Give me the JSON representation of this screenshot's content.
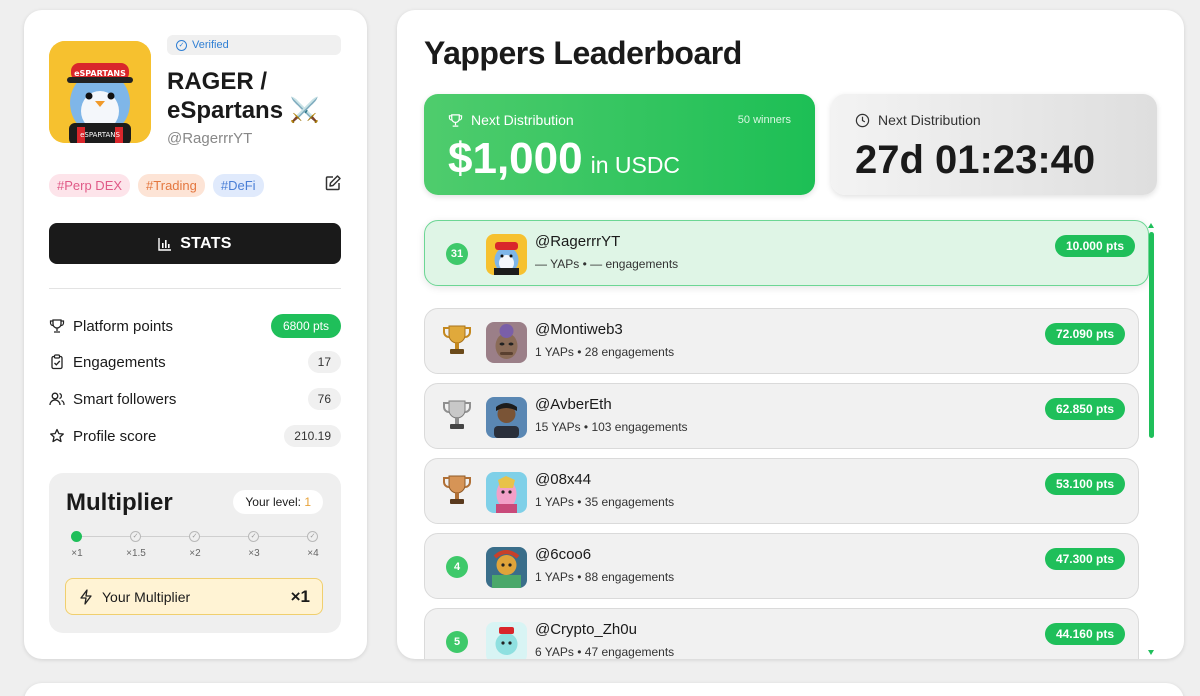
{
  "profile": {
    "verified": "Verified",
    "name": "RAGER / eSpartans ⚔️",
    "handle": "@RagerrrYT",
    "tags": [
      "#Perp DEX",
      "#Trading",
      "#DeFi"
    ],
    "stats_button": "STATS",
    "stats": [
      {
        "label": "Platform points",
        "value": "6800 pts",
        "icon": "trophy-icon"
      },
      {
        "label": "Engagements",
        "value": "17",
        "icon": "clipboard-icon"
      },
      {
        "label": "Smart followers",
        "value": "76",
        "icon": "users-icon"
      },
      {
        "label": "Profile score",
        "value": "210.19",
        "icon": "star-icon"
      }
    ]
  },
  "multiplier": {
    "title": "Multiplier",
    "level_label": "Your level:",
    "level_value": "1",
    "steps": [
      "×1",
      "×1.5",
      "×2",
      "×3",
      "×4"
    ],
    "your_multiplier_label": "Your Multiplier",
    "your_multiplier_value": "×1"
  },
  "leaderboard": {
    "title": "Yappers Leaderboard",
    "prize": {
      "label": "Next Distribution",
      "winners": "50 winners",
      "amount": "$1,000",
      "unit": "in USDC"
    },
    "countdown": {
      "label": "Next Distribution",
      "timer": "27d 01:23:40"
    },
    "entries": [
      {
        "rank": "31",
        "handle": "@RagerrrYT",
        "sub": "— YAPs • — engagements",
        "points": "10.000 pts",
        "me": true
      },
      {
        "rank": "gold",
        "handle": "@Montiweb3",
        "sub": "1 YAPs • 28 engagements",
        "points": "72.090 pts"
      },
      {
        "rank": "silver",
        "handle": "@AvberEth",
        "sub": "15 YAPs • 103 engagements",
        "points": "62.850 pts"
      },
      {
        "rank": "bronze",
        "handle": "@08x44",
        "sub": "1 YAPs • 35 engagements",
        "points": "53.100 pts"
      },
      {
        "rank": "4",
        "handle": "@6coo6",
        "sub": "1 YAPs • 88 engagements",
        "points": "47.300 pts"
      },
      {
        "rank": "5",
        "handle": "@Crypto_Zh0u",
        "sub": "6 YAPs • 47 engagements",
        "points": "44.160 pts"
      }
    ]
  },
  "colors": {
    "accent": "#1fbf5a",
    "gold": "#e0a93b",
    "silver": "#9a9a9a",
    "bronze": "#c98a45"
  }
}
